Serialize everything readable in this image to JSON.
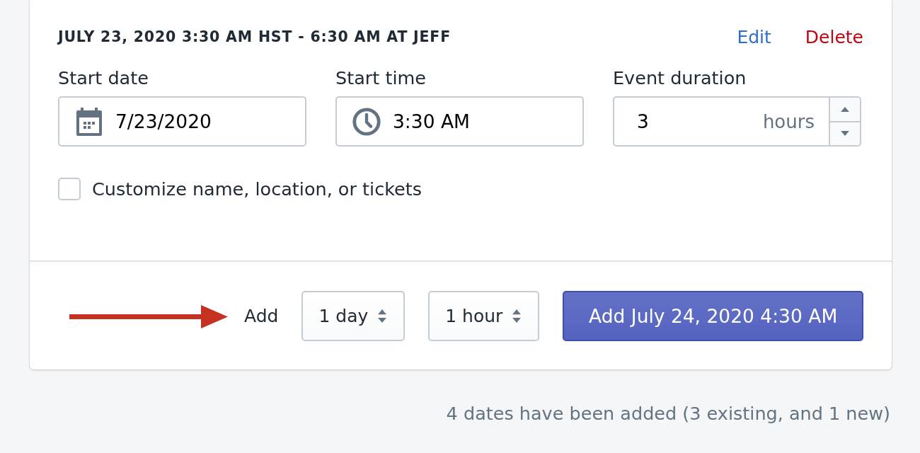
{
  "event": {
    "heading": "JULY 23, 2020 3:30 AM HST - 6:30 AM AT JEFF",
    "actions": [
      {
        "label": "Edit",
        "kind": "edit"
      },
      {
        "label": "Delete",
        "kind": "delete"
      }
    ],
    "fields": [
      {
        "kind": "date",
        "label": "Start date",
        "value": "7/23/2020"
      },
      {
        "kind": "time",
        "label": "Start time",
        "value": "3:30 AM"
      },
      {
        "kind": "number",
        "label": "Event duration",
        "value": "3",
        "unit": "hours"
      }
    ],
    "customize": {
      "label": "Customize name, location, or tickets",
      "checked": false
    }
  },
  "add_row": {
    "label": "Add",
    "selects": [
      {
        "value": "1 day"
      },
      {
        "value": "1 hour"
      }
    ],
    "button": "Add July 24, 2020 4:30 AM"
  },
  "summary": "4 dates have been added (3 existing, and 1 new)"
}
